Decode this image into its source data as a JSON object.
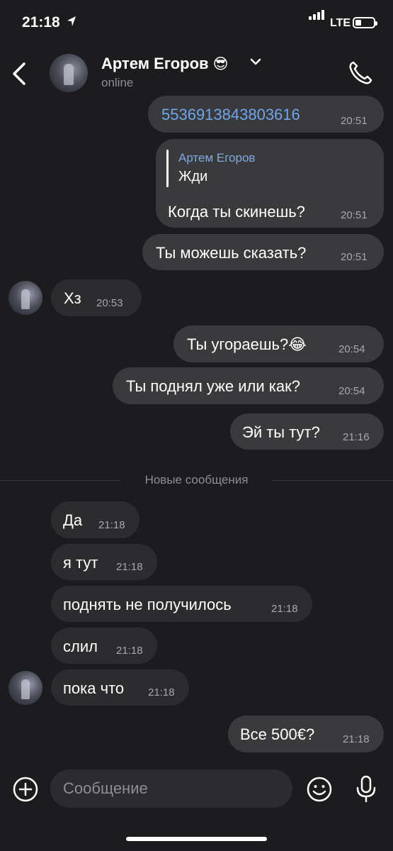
{
  "status": {
    "time": "21:18",
    "network": "LTE"
  },
  "header": {
    "name": "Артем Егоров",
    "emoji": "😎",
    "presence": "online"
  },
  "messages": [
    {
      "text": "5536913843803616",
      "time": "20:51"
    },
    {
      "quote_author": "Артем Егоров",
      "quote_text": "Жди",
      "text": "Когда ты скинешь?",
      "time": "20:51"
    },
    {
      "text": "Ты можешь сказать?",
      "time": "20:51"
    },
    {
      "text": "Хз",
      "time": "20:53"
    },
    {
      "text": "Ты угораешь?😂",
      "time": "20:54"
    },
    {
      "text": "Ты поднял уже или как?",
      "time": "20:54"
    },
    {
      "text": "Эй ты тут?",
      "time": "21:16"
    },
    {
      "text": "Да",
      "time": "21:18"
    },
    {
      "text": "я тут",
      "time": "21:18"
    },
    {
      "text": "поднять не получилось",
      "time": "21:18"
    },
    {
      "text": "слил",
      "time": "21:18"
    },
    {
      "text": "пока что",
      "time": "21:18"
    },
    {
      "text": "Все 500€?",
      "time": "21:18"
    }
  ],
  "divider": {
    "label": "Новые сообщения"
  },
  "composer": {
    "placeholder": "Сообщение"
  },
  "colors": {
    "background": "#1c1c1e",
    "outgoing_bubble": "#3a3a3c",
    "incoming_bubble": "#2c2c2e",
    "link": "#6ea6ee"
  },
  "icons": [
    "location-arrow-icon",
    "signal-icon",
    "battery-icon",
    "back-chevron-icon",
    "chevron-down-icon",
    "phone-icon",
    "plus-circle-icon",
    "smile-icon",
    "microphone-icon"
  ]
}
